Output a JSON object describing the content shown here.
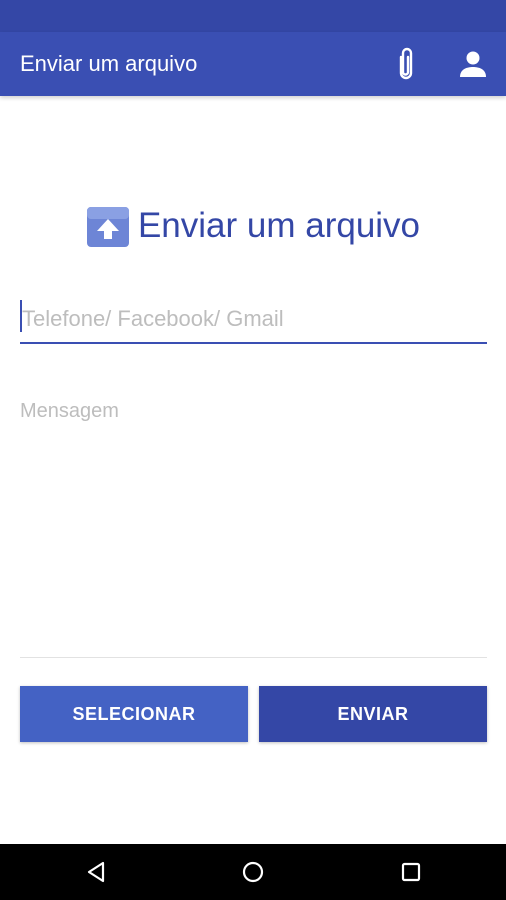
{
  "app_bar": {
    "title": "Enviar um arquivo",
    "icons": [
      "paperclip-icon",
      "account-icon"
    ],
    "color": "#3a4fb3"
  },
  "heading": {
    "icon": "upload-icon",
    "text": "Enviar um arquivo"
  },
  "form": {
    "recipient_placeholder": "Telefone/ Facebook/ Gmail",
    "recipient_value": "",
    "message_placeholder": "Mensagem",
    "message_value": ""
  },
  "buttons": {
    "select_label": "SELECIONAR",
    "send_label": "ENVIAR"
  },
  "colors": {
    "primary": "#3a4fb3",
    "primary_dark": "#3447a6",
    "accent_button": "#4462c4"
  },
  "nav_bar": {
    "icons": [
      "back-icon",
      "home-icon",
      "recents-icon"
    ]
  }
}
